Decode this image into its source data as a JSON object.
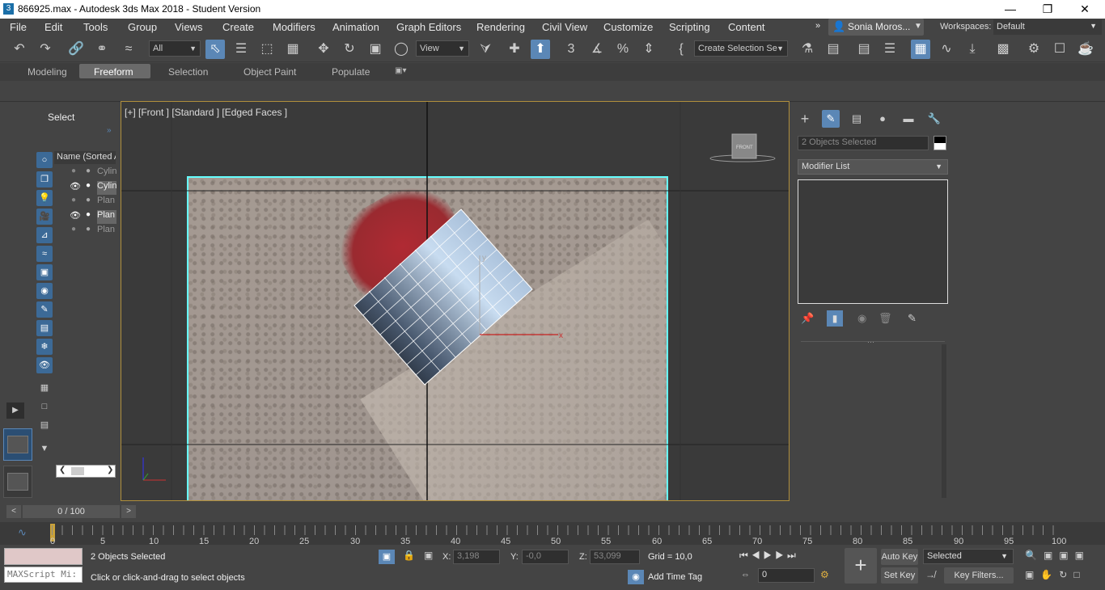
{
  "window": {
    "title": "866925.max - Autodesk 3ds Max 2018 - Student Version",
    "app_icon": "3"
  },
  "menu": [
    "File",
    "Edit",
    "Tools",
    "Group",
    "Views",
    "Create",
    "Modifiers",
    "Animation",
    "Graph Editors",
    "Rendering",
    "Civil View",
    "Customize",
    "Scripting",
    "Content"
  ],
  "user": {
    "name": "Sonia Moros..."
  },
  "workspaces": {
    "label": "Workspaces:",
    "value": "Default"
  },
  "toolbar": {
    "filter": "All",
    "ref_coord": "View",
    "selection_set": "Create Selection Se"
  },
  "ribbon": {
    "tabs": [
      "Modeling",
      "Freeform",
      "Selection",
      "Object Paint",
      "Populate"
    ],
    "active": "Freeform"
  },
  "scene_explorer": {
    "title": "Select",
    "column": "Name (Sorted A",
    "rows": [
      "Cylin",
      "Cylin",
      "Plan",
      "Plan",
      "Plan"
    ]
  },
  "viewport": {
    "label": "[+] [Front ] [Standard ] [Edged Faces ]",
    "viewcube": "FRONT",
    "gizmo_x": "x",
    "gizmo_y": "y"
  },
  "command_panel": {
    "selection_name": "2 Objects Selected",
    "modifier_list": "Modifier List"
  },
  "timeline": {
    "frame": "0 / 100",
    "ticks": [
      "0",
      "5",
      "10",
      "15",
      "20",
      "25",
      "30",
      "35",
      "40",
      "45",
      "50",
      "55",
      "60",
      "65",
      "70",
      "75",
      "80",
      "85",
      "90",
      "95",
      "100"
    ]
  },
  "status": {
    "maxscript": "MAXScript Mi:",
    "objects_selected": "2 Objects Selected",
    "prompt": "Click or click-and-drag to select objects",
    "x_label": "X:",
    "x": "3,198",
    "y_label": "Y:",
    "y": "-0,0",
    "z_label": "Z:",
    "z": "53,099",
    "grid": "Grid = 10,0",
    "add_time_tag": "Add Time Tag",
    "auto_key": "Auto Key",
    "set_key": "Set Key",
    "key_mode": "Selected",
    "frame": "0",
    "key_filters": "Key Filters..."
  }
}
